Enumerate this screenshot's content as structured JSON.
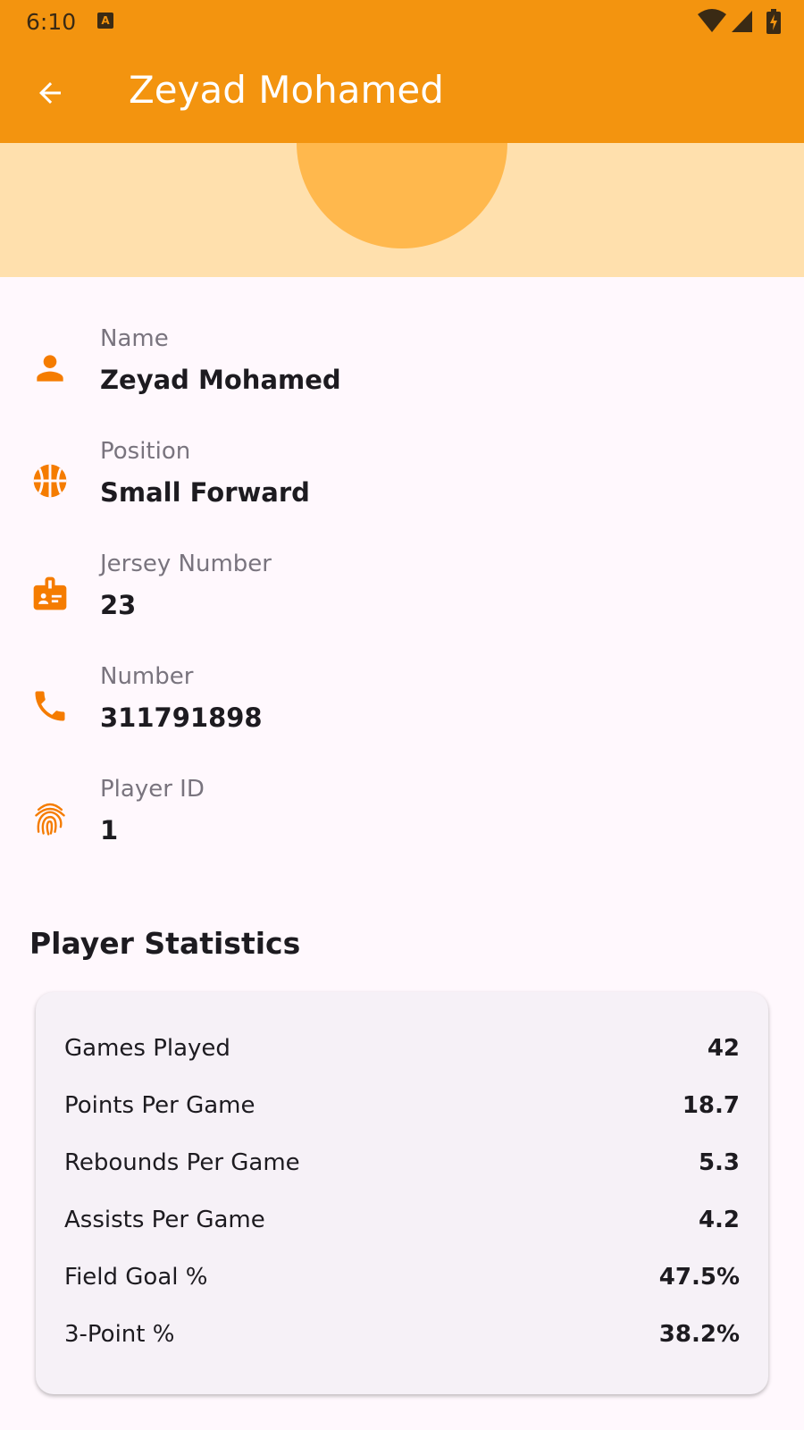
{
  "status_bar": {
    "time": "6:10",
    "icons": [
      "notification-a-icon",
      "wifi-icon",
      "cell-signal-icon",
      "battery-charging-icon"
    ]
  },
  "app_bar": {
    "title": "Zeyad Mohamed",
    "back_icon": "arrow-back-icon"
  },
  "colors": {
    "primary": "#f3940f",
    "header_band": "#ffe0ad",
    "avatar": "#ffb84d",
    "icon": "#f57c00",
    "background": "#fff8fd",
    "card": "#f6f1f7"
  },
  "details": [
    {
      "icon": "person-icon",
      "label": "Name",
      "value": "Zeyad Mohamed"
    },
    {
      "icon": "basketball-icon",
      "label": "Position",
      "value": "Small Forward"
    },
    {
      "icon": "badge-icon",
      "label": "Jersey Number",
      "value": "23"
    },
    {
      "icon": "phone-icon",
      "label": "Number",
      "value": "311791898"
    },
    {
      "icon": "fingerprint-icon",
      "label": "Player ID",
      "value": "1"
    }
  ],
  "statistics": {
    "title": "Player Statistics",
    "rows": [
      {
        "label": "Games Played",
        "value": "42"
      },
      {
        "label": "Points Per Game",
        "value": "18.7"
      },
      {
        "label": "Rebounds Per Game",
        "value": "5.3"
      },
      {
        "label": "Assists Per Game",
        "value": "4.2"
      },
      {
        "label": "Field Goal %",
        "value": "47.5%"
      },
      {
        "label": "3-Point %",
        "value": "38.2%"
      }
    ]
  }
}
